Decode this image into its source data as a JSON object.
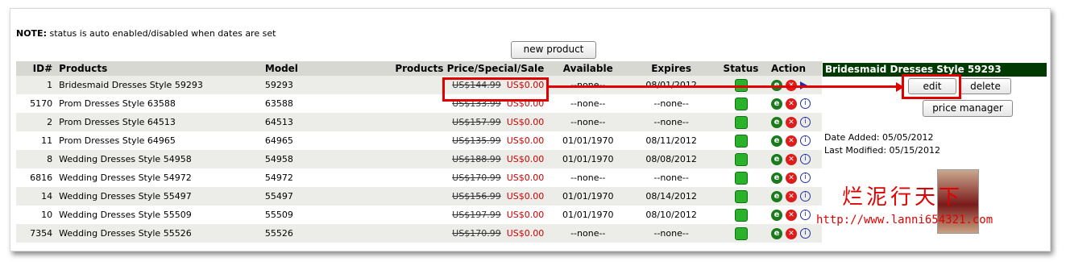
{
  "note": {
    "bold": "NOTE:",
    "text": " status is auto enabled/disabled when dates are set"
  },
  "buttons": {
    "new_product": "new product",
    "edit": "edit",
    "delete": "delete",
    "price_manager": "price manager"
  },
  "columns": [
    "ID#",
    "Products",
    "Model",
    "Products Price/Special/Sale",
    "Available",
    "Expires",
    "Status",
    "Action"
  ],
  "rows": [
    {
      "id": "1",
      "product": "Bridesmaid Dresses Style 59293",
      "model": "59293",
      "old_price": "US$144.99",
      "sale": "US$0.00",
      "available": "--none--",
      "expires": "08/01/2012"
    },
    {
      "id": "5170",
      "product": "Prom Dresses Style 63588",
      "model": "63588",
      "old_price": "US$133.99",
      "sale": "US$0.00",
      "available": "--none--",
      "expires": "--none--"
    },
    {
      "id": "2",
      "product": "Prom Dresses Style 64513",
      "model": "64513",
      "old_price": "US$157.99",
      "sale": "US$0.00",
      "available": "--none--",
      "expires": "--none--"
    },
    {
      "id": "11",
      "product": "Prom Dresses Style 64965",
      "model": "64965",
      "old_price": "US$135.99",
      "sale": "US$0.00",
      "available": "01/01/1970",
      "expires": "08/11/2012"
    },
    {
      "id": "8",
      "product": "Wedding Dresses Style 54958",
      "model": "54958",
      "old_price": "US$188.99",
      "sale": "US$0.00",
      "available": "01/01/1970",
      "expires": "08/08/2012"
    },
    {
      "id": "6816",
      "product": "Wedding Dresses Style 54972",
      "model": "54972",
      "old_price": "US$170.99",
      "sale": "US$0.00",
      "available": "--none--",
      "expires": "--none--"
    },
    {
      "id": "14",
      "product": "Wedding Dresses Style 55497",
      "model": "55497",
      "old_price": "US$156.99",
      "sale": "US$0.00",
      "available": "01/01/1970",
      "expires": "08/14/2012"
    },
    {
      "id": "10",
      "product": "Wedding Dresses Style 55509",
      "model": "55509",
      "old_price": "US$197.99",
      "sale": "US$0.00",
      "available": "01/01/1970",
      "expires": "08/10/2012"
    },
    {
      "id": "7354",
      "product": "Wedding Dresses Style 55526",
      "model": "55526",
      "old_price": "US$170.99",
      "sale": "US$0.00",
      "available": "--none--",
      "expires": "--none--"
    }
  ],
  "panel": {
    "title": "Bridesmaid Dresses Style 59293",
    "date_added": "Date Added: 05/05/2012",
    "last_modified": "Last Modified: 05/15/2012"
  },
  "watermark": {
    "chinese": "烂泥行天下",
    "url": "http://www.lanni654321.com"
  },
  "icons": {
    "edit": "edit-e-icon",
    "delete": "delete-x-icon",
    "info": "info-icon",
    "selected": "arrow-right-icon",
    "status": "status-green-icon"
  },
  "colors": {
    "header_bg": "#d8d8d2",
    "panel_head": "#003a00",
    "sale": "#d00000",
    "status_on": "#2bb22b",
    "annotation": "#e00000"
  }
}
